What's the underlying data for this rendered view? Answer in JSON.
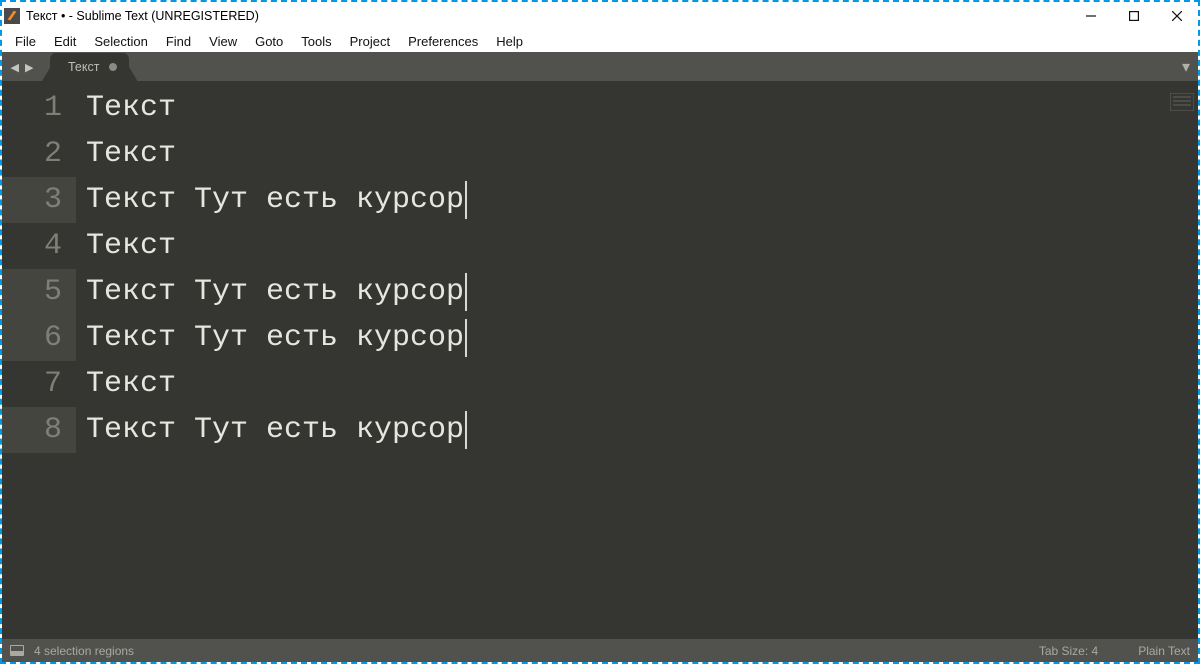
{
  "window": {
    "title": "Текст • - Sublime Text (UNREGISTERED)"
  },
  "menu": {
    "items": [
      "File",
      "Edit",
      "Selection",
      "Find",
      "View",
      "Goto",
      "Tools",
      "Project",
      "Preferences",
      "Help"
    ]
  },
  "tabs": {
    "active": {
      "label": "Текст",
      "dirty": true
    }
  },
  "editor": {
    "lines": [
      {
        "num": "1",
        "text": "Текст",
        "cursor": false,
        "hl": false
      },
      {
        "num": "2",
        "text": "Текст",
        "cursor": false,
        "hl": false
      },
      {
        "num": "3",
        "text": "Текст Тут есть курсор",
        "cursor": true,
        "hl": true
      },
      {
        "num": "4",
        "text": "Текст",
        "cursor": false,
        "hl": false
      },
      {
        "num": "5",
        "text": "Текст Тут есть курсор",
        "cursor": true,
        "hl": true
      },
      {
        "num": "6",
        "text": "Текст Тут есть курсор",
        "cursor": true,
        "hl": true
      },
      {
        "num": "7",
        "text": "Текст",
        "cursor": false,
        "hl": false
      },
      {
        "num": "8",
        "text": "Текст Тут есть курсор",
        "cursor": true,
        "hl": true
      }
    ]
  },
  "status": {
    "left": "4 selection regions",
    "tab_size": "Tab Size: 4",
    "syntax": "Plain Text"
  }
}
